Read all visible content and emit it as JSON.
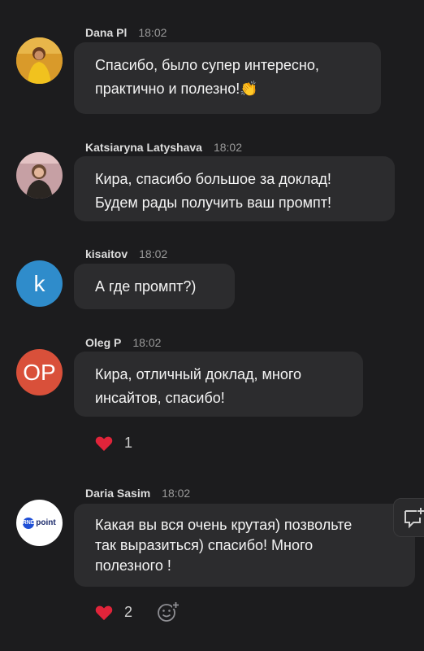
{
  "messages": [
    {
      "name": "Dana Pl",
      "time": "18:02",
      "lines": [
        "Спасибо, было супер интересно,",
        "практично и полезно!👏"
      ],
      "avatar_kind": "photo",
      "avatar_bg": "#e0a52a"
    },
    {
      "name": "Katsiaryna Latyshava",
      "time": "18:02",
      "lines": [
        "Кира, спасибо большое за доклад!",
        "Будем рады получить ваш промпт!"
      ],
      "avatar_kind": "photo",
      "avatar_bg": "#c79aa0"
    },
    {
      "name": "kisaitov",
      "time": "18:02",
      "lines": [
        "А где промпт?)"
      ],
      "avatar_kind": "initials",
      "avatar_text": "k",
      "avatar_bg": "#2f8ccb"
    },
    {
      "name": "Oleg P",
      "time": "18:02",
      "lines": [
        "Кира, отличный доклад, много",
        "инсайтов, спасибо!"
      ],
      "avatar_kind": "initials",
      "avatar_text": "OP",
      "avatar_bg": "#d9503a",
      "reaction": {
        "emoji": "heart",
        "count": "1"
      }
    },
    {
      "name": "Daria Sasim",
      "time": "18:02",
      "lines": [
        "Какая вы вся очень крутая) позвольте",
        "так выразиться) спасибо! Много",
        "полезного !"
      ],
      "avatar_kind": "logo",
      "avatar_text": "point",
      "avatar_badge": "RND",
      "avatar_bg": "#ffffff",
      "reaction": {
        "emoji": "heart",
        "count": "2"
      }
    }
  ],
  "icons": {
    "add_reaction": "smiley-plus-icon",
    "side_action": "comment-plus-icon"
  },
  "colors": {
    "background": "#1c1c1e",
    "bubble": "#2c2c2e",
    "heart": "#e0243a"
  }
}
